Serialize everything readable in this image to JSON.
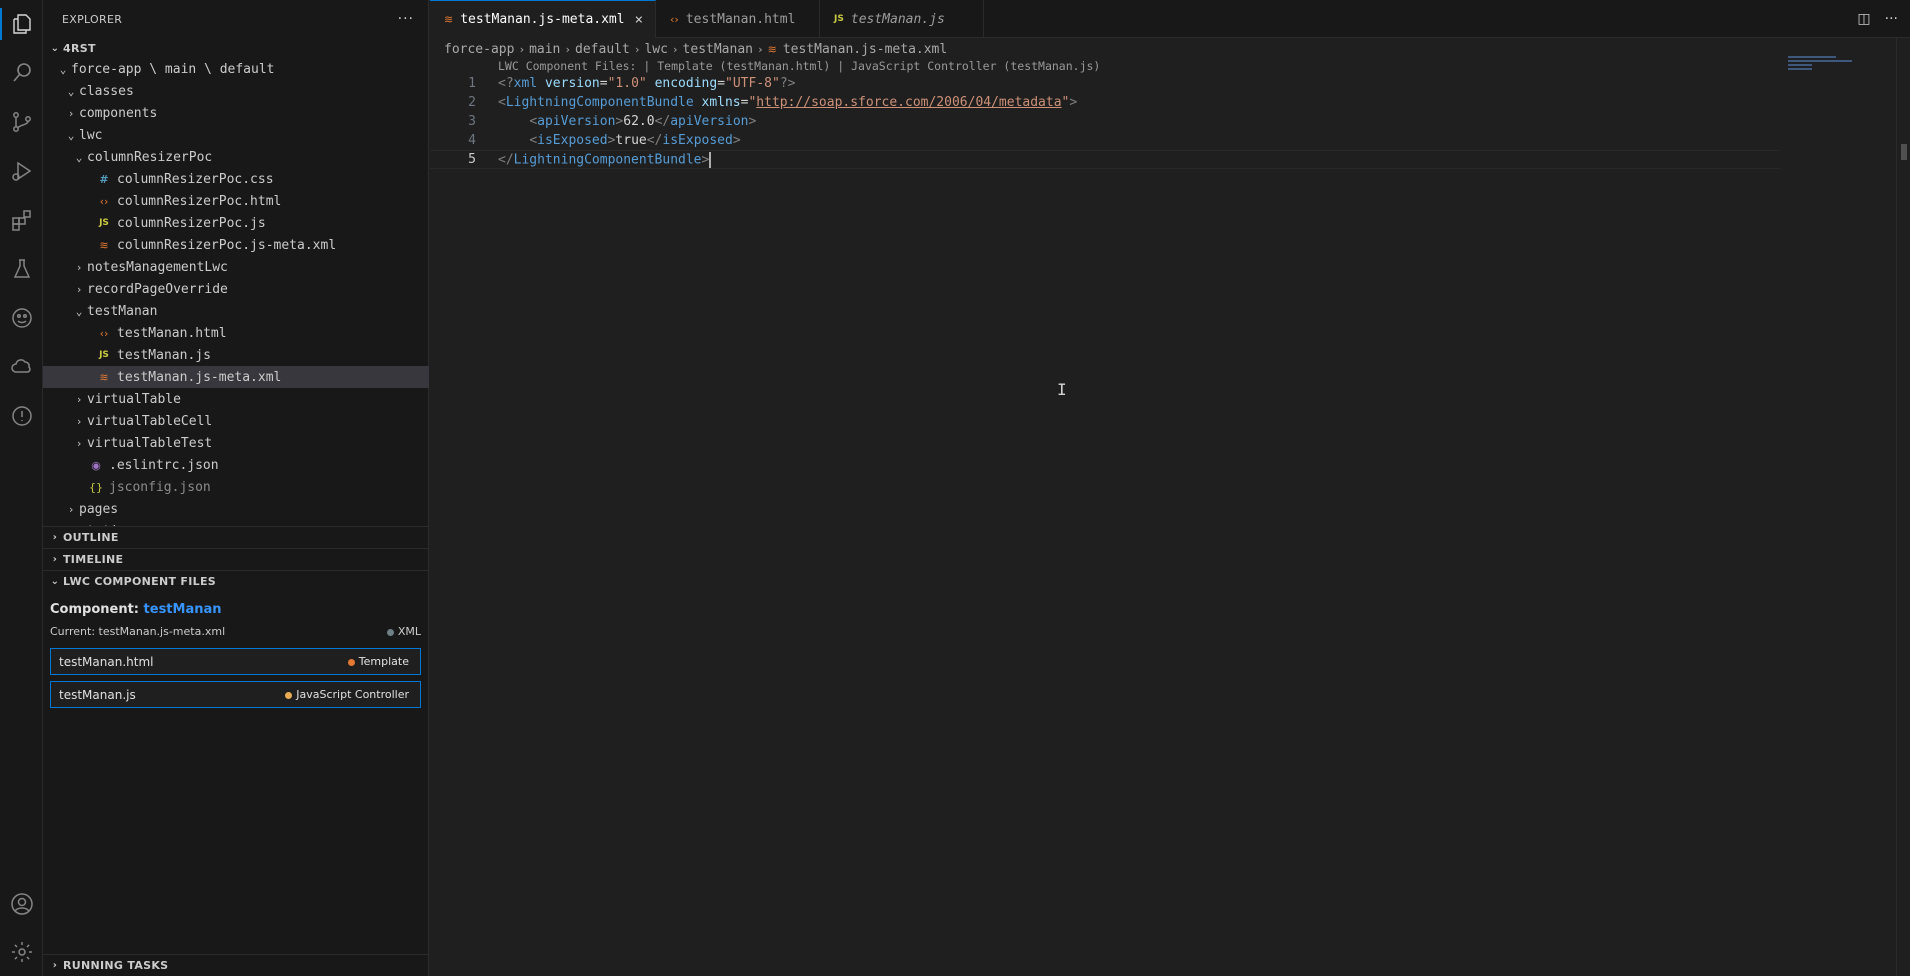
{
  "sidebar": {
    "title": "EXPLORER",
    "title_actions": "···",
    "root": "4RST",
    "tree": [
      {
        "label": "force-app \\ main \\ default",
        "indent": 1,
        "twisty": "down",
        "icon": ""
      },
      {
        "label": "classes",
        "indent": 2,
        "twisty": "down",
        "icon": ""
      },
      {
        "label": "components",
        "indent": 2,
        "twisty": "right",
        "icon": ""
      },
      {
        "label": "lwc",
        "indent": 2,
        "twisty": "down",
        "icon": ""
      },
      {
        "label": "columnResizerPoc",
        "indent": 3,
        "twisty": "down",
        "icon": ""
      },
      {
        "label": "columnResizerPoc.css",
        "indent": 4,
        "twisty": "",
        "icon": "css"
      },
      {
        "label": "columnResizerPoc.html",
        "indent": 4,
        "twisty": "",
        "icon": "html"
      },
      {
        "label": "columnResizerPoc.js",
        "indent": 4,
        "twisty": "",
        "icon": "js"
      },
      {
        "label": "columnResizerPoc.js-meta.xml",
        "indent": 4,
        "twisty": "",
        "icon": "xml"
      },
      {
        "label": "notesManagementLwc",
        "indent": 3,
        "twisty": "right",
        "icon": ""
      },
      {
        "label": "recordPageOverride",
        "indent": 3,
        "twisty": "right",
        "icon": ""
      },
      {
        "label": "testManan",
        "indent": 3,
        "twisty": "down",
        "icon": ""
      },
      {
        "label": "testManan.html",
        "indent": 4,
        "twisty": "",
        "icon": "html"
      },
      {
        "label": "testManan.js",
        "indent": 4,
        "twisty": "",
        "icon": "js"
      },
      {
        "label": "testManan.js-meta.xml",
        "indent": 4,
        "twisty": "",
        "icon": "xml",
        "selected": true
      },
      {
        "label": "virtualTable",
        "indent": 3,
        "twisty": "right",
        "icon": ""
      },
      {
        "label": "virtualTableCell",
        "indent": 3,
        "twisty": "right",
        "icon": ""
      },
      {
        "label": "virtualTableTest",
        "indent": 3,
        "twisty": "right",
        "icon": ""
      },
      {
        "label": ".eslintrc.json",
        "indent": 3,
        "twisty": "",
        "icon": "eslint"
      },
      {
        "label": "jsconfig.json",
        "indent": 3,
        "twisty": "",
        "icon": "json",
        "dim": true
      },
      {
        "label": "pages",
        "indent": 2,
        "twisty": "right",
        "icon": ""
      },
      {
        "label": "staticresources",
        "indent": 2,
        "twisty": "down",
        "icon": ""
      }
    ],
    "sections": {
      "outline": "OUTLINE",
      "timeline": "TIMELINE",
      "lwc_files": "LWC COMPONENT FILES",
      "running_tasks": "RUNNING TASKS"
    },
    "lwc_panel": {
      "component_label": "Component:",
      "component_name": "testManan",
      "current_label": "Current: testManan.js-meta.xml",
      "current_badge": "XML",
      "files": [
        {
          "name": "testManan.html",
          "tag": "Template",
          "color": "#e37933"
        },
        {
          "name": "testManan.js",
          "tag": "JavaScript Controller",
          "color": "#e8ab53"
        }
      ]
    }
  },
  "editor": {
    "tabs": [
      {
        "label": "testManan.js-meta.xml",
        "icon": "xml",
        "active": true,
        "close": "×"
      },
      {
        "label": "testManan.html",
        "icon": "html",
        "active": false
      },
      {
        "label": "testManan.js",
        "icon": "js",
        "active": false,
        "italic": true
      }
    ],
    "breadcrumb": [
      "force-app",
      "main",
      "default",
      "lwc",
      "testManan",
      "testManan.js-meta.xml"
    ],
    "codelens": "LWC Component Files: | Template (testManan.html) | JavaScript Controller (testManan.js)",
    "lines": [
      {
        "n": "1",
        "parts": [
          [
            "c-punc",
            "<?"
          ],
          [
            "c-tag",
            "xml"
          ],
          [
            "c-text",
            " "
          ],
          [
            "c-attr",
            "version"
          ],
          [
            "c-text",
            "="
          ],
          [
            "c-str",
            "\"1.0\""
          ],
          [
            "c-text",
            " "
          ],
          [
            "c-attr",
            "encoding"
          ],
          [
            "c-text",
            "="
          ],
          [
            "c-str",
            "\"UTF-8\""
          ],
          [
            "c-punc",
            "?>"
          ]
        ]
      },
      {
        "n": "2",
        "parts": [
          [
            "c-punc",
            "<"
          ],
          [
            "c-tag",
            "LightningComponentBundle"
          ],
          [
            "c-text",
            " "
          ],
          [
            "c-attr",
            "xmlns"
          ],
          [
            "c-text",
            "="
          ],
          [
            "c-str",
            "\""
          ],
          [
            "c-url",
            "http://soap.sforce.com/2006/04/metadata"
          ],
          [
            "c-str",
            "\""
          ],
          [
            "c-punc",
            ">"
          ]
        ]
      },
      {
        "n": "3",
        "parts": [
          [
            "c-text",
            "    "
          ],
          [
            "c-punc",
            "<"
          ],
          [
            "c-tag",
            "apiVersion"
          ],
          [
            "c-punc",
            ">"
          ],
          [
            "c-text",
            "62.0"
          ],
          [
            "c-punc",
            "</"
          ],
          [
            "c-tag",
            "apiVersion"
          ],
          [
            "c-punc",
            ">"
          ]
        ]
      },
      {
        "n": "4",
        "parts": [
          [
            "c-text",
            "    "
          ],
          [
            "c-punc",
            "<"
          ],
          [
            "c-tag",
            "isExposed"
          ],
          [
            "c-punc",
            ">"
          ],
          [
            "c-text",
            "true"
          ],
          [
            "c-punc",
            "</"
          ],
          [
            "c-tag",
            "isExposed"
          ],
          [
            "c-punc",
            ">"
          ]
        ]
      },
      {
        "n": "5",
        "current": true,
        "parts": [
          [
            "c-punc",
            "</"
          ],
          [
            "c-tag",
            "LightningComponentBundle"
          ],
          [
            "c-punc",
            ">"
          ]
        ]
      }
    ]
  },
  "icons": {
    "activity": [
      "explorer-icon",
      "search-icon",
      "source-control-icon",
      "run-debug-icon",
      "extensions-icon",
      "testing-icon",
      "salesforce-icon",
      "org-browser-icon",
      "problems-icon",
      "account-icon",
      "settings-gear-icon"
    ]
  }
}
